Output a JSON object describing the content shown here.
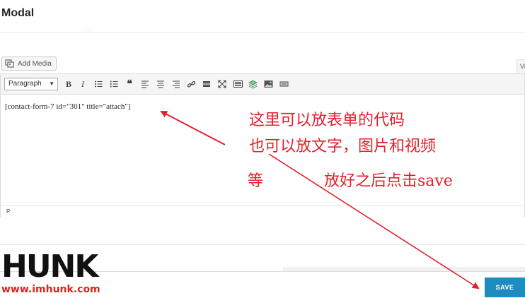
{
  "modal": {
    "title": "Modal"
  },
  "media": {
    "add_media_label": "Add Media"
  },
  "editor": {
    "visual_tab_label": "Vi",
    "format_select_value": "Paragraph",
    "toolbar": {
      "bold_label": "B",
      "italic_label": "I",
      "icons": [
        "bold-icon",
        "italic-icon",
        "bulleted-list-icon",
        "numbered-list-icon",
        "blockquote-icon",
        "align-left-icon",
        "align-center-icon",
        "align-right-icon",
        "link-icon",
        "read-more-icon",
        "fullscreen-icon",
        "keyboard-icon",
        "layers-icon",
        "image-icon",
        "toolbar-toggle-icon"
      ]
    },
    "content": "[contact-form-7 id=\"301\" title=\"attach\"]",
    "path": "P"
  },
  "actions": {
    "save_label": "SAVE"
  },
  "annotations": {
    "line1": "这里可以放表单的代码",
    "line2": "也可以放文字，图片和视频",
    "line3": "等",
    "line4": "放好之后点击save"
  },
  "watermark": {
    "logo": "HUNK",
    "url": "www.imhunk.com"
  },
  "colors": {
    "annotation": "#e41f2b",
    "save_button": "#1e8cbe",
    "watermark_url": "#e0241a"
  }
}
